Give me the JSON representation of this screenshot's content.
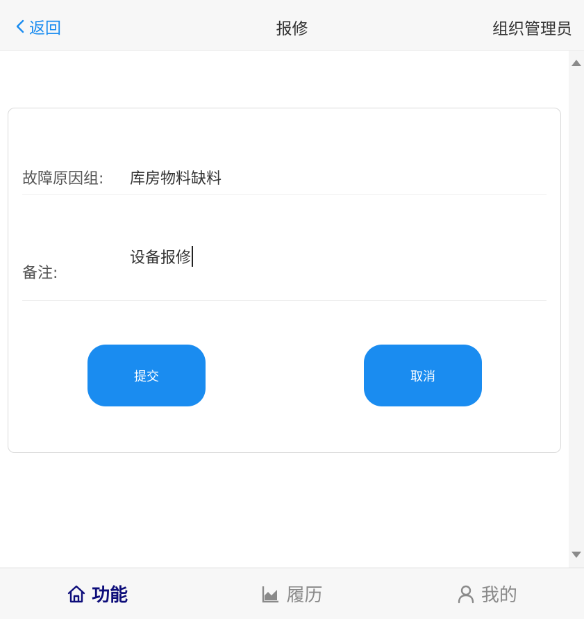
{
  "header": {
    "back_label": "返回",
    "title": "报修",
    "user_role": "组织管理员"
  },
  "form": {
    "reason_group_label": "故障原因组:",
    "reason_group_value": "库房物料缺料",
    "remark_label": "备注:",
    "remark_value": "设备报修",
    "submit_label": "提交",
    "cancel_label": "取消"
  },
  "tabbar": {
    "items": [
      {
        "label": "功能",
        "icon": "home-icon",
        "active": true
      },
      {
        "label": "履历",
        "icon": "chart-icon",
        "active": false
      },
      {
        "label": "我的",
        "icon": "user-icon",
        "active": false
      }
    ]
  },
  "colors": {
    "accent": "#1a8cf0",
    "active_tab": "#0d0d7a",
    "inactive_tab": "#8a8a8a"
  }
}
